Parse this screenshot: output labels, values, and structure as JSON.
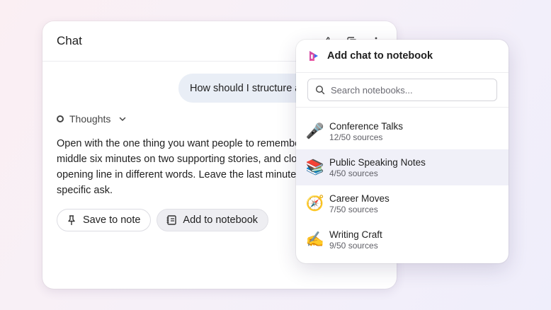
{
  "chat": {
    "title": "Chat",
    "header_icons": [
      "thumb-icon",
      "copy-icon",
      "more-icon"
    ],
    "user_message": "How should I structure a",
    "thoughts_label": "Thoughts",
    "answer_lines": [
      "Open with the one thing you want people to remember",
      "middle six minutes on two supporting stories, and clos",
      "opening line in different words. Leave the last minute",
      "specific ask."
    ],
    "actions": {
      "save_label": "Save to note",
      "add_label": "Add to notebook"
    }
  },
  "popover": {
    "title": "Add chat to notebook",
    "search_placeholder": "Search notebooks...",
    "notebooks": [
      {
        "emoji": "🎤",
        "name": "Conference Talks",
        "count": "12/50 sources"
      },
      {
        "emoji": "📚",
        "name": "Public Speaking Notes",
        "count": "4/50 sources"
      },
      {
        "emoji": "🧭",
        "name": "Career Moves",
        "count": "7/50 sources"
      },
      {
        "emoji": "✍️",
        "name": "Writing Craft",
        "count": "9/50 sources"
      }
    ]
  },
  "colors": {
    "bubble_bg": "#e9eef6",
    "highlight_bg": "#f0f0f8",
    "logo_pink": "#e8489a",
    "logo_blue": "#3b6cf0"
  }
}
